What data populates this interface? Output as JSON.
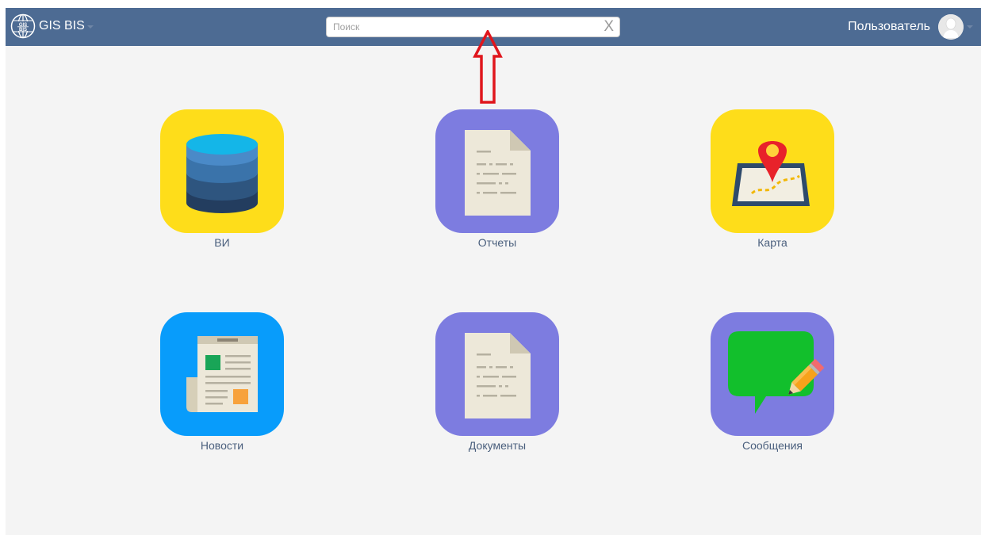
{
  "header": {
    "brand_logo_text": [
      "GIS",
      "BIS"
    ],
    "brand_name": "GIS BIS",
    "search_placeholder": "Поиск",
    "search_clear_label": "X",
    "user_name": "Пользователь"
  },
  "tiles": [
    {
      "label": "ВИ",
      "icon": "database-icon",
      "color": "#fedd1a"
    },
    {
      "label": "Отчеты",
      "icon": "document-icon",
      "color": "#7d7ce0"
    },
    {
      "label": "Карта",
      "icon": "map-pin-icon",
      "color": "#fedd1a"
    },
    {
      "label": "Новости",
      "icon": "newspaper-icon",
      "color": "#089cfb"
    },
    {
      "label": "Документы",
      "icon": "document-icon",
      "color": "#7d7ce0"
    },
    {
      "label": "Сообщения",
      "icon": "chat-pencil-icon",
      "color": "#7d7ce0"
    }
  ],
  "colors": {
    "header_bg": "#4d6b93",
    "page_bg": "#f4f4f4",
    "annotation_arrow": "#e0161d",
    "label_text": "#4a5f7d"
  }
}
